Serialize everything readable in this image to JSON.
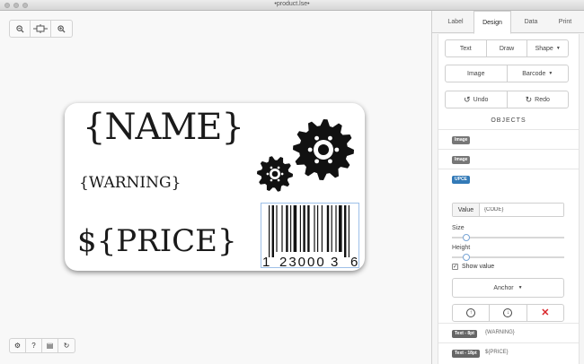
{
  "window": {
    "title": "•product.lse•"
  },
  "canvas": {
    "zoom_tools": [
      "zoom-out-icon",
      "fit-icon",
      "zoom-in-icon"
    ],
    "bottom_tools": [
      "gear-icon",
      "help-icon",
      "grid-icon",
      "refresh-icon"
    ],
    "label": {
      "name_text": "{NAME}",
      "warning_text": "{WARNING}",
      "price_text": "${PRICE}",
      "barcode_digits": [
        "1",
        "23000",
        "3",
        "6"
      ]
    }
  },
  "panel": {
    "tabs": [
      {
        "label": "Label"
      },
      {
        "label": "Design"
      },
      {
        "label": "Data"
      },
      {
        "label": "Print"
      }
    ],
    "active_tab": "Design",
    "toolbar1": {
      "text": "Text",
      "draw": "Draw",
      "shape": "Shape"
    },
    "toolbar2": {
      "image": "Image",
      "barcode": "Barcode"
    },
    "history": {
      "undo": "Undo",
      "redo": "Redo"
    },
    "objects_header": "OBJECTS",
    "objects": [
      {
        "badge": "Image",
        "text": ""
      },
      {
        "badge": "Image",
        "text": ""
      },
      {
        "badge": "UPCE",
        "text": ""
      }
    ],
    "editor": {
      "value_label": "Value",
      "value": "{CODE}",
      "size_label": "Size",
      "size_value": 0.1,
      "height_label": "Height",
      "height_value": 0.1,
      "show_value_label": "Show value",
      "show_value_checked": true,
      "anchor_label": "Anchor"
    },
    "more_objects": [
      {
        "badge": "Text - 8pt",
        "text": "{WARNING}"
      },
      {
        "badge": "Text - 18pt",
        "text": "${PRICE}"
      }
    ],
    "colors": {
      "accent": "#337ab7",
      "delete": "#d9262b",
      "badge": "#777777"
    }
  }
}
